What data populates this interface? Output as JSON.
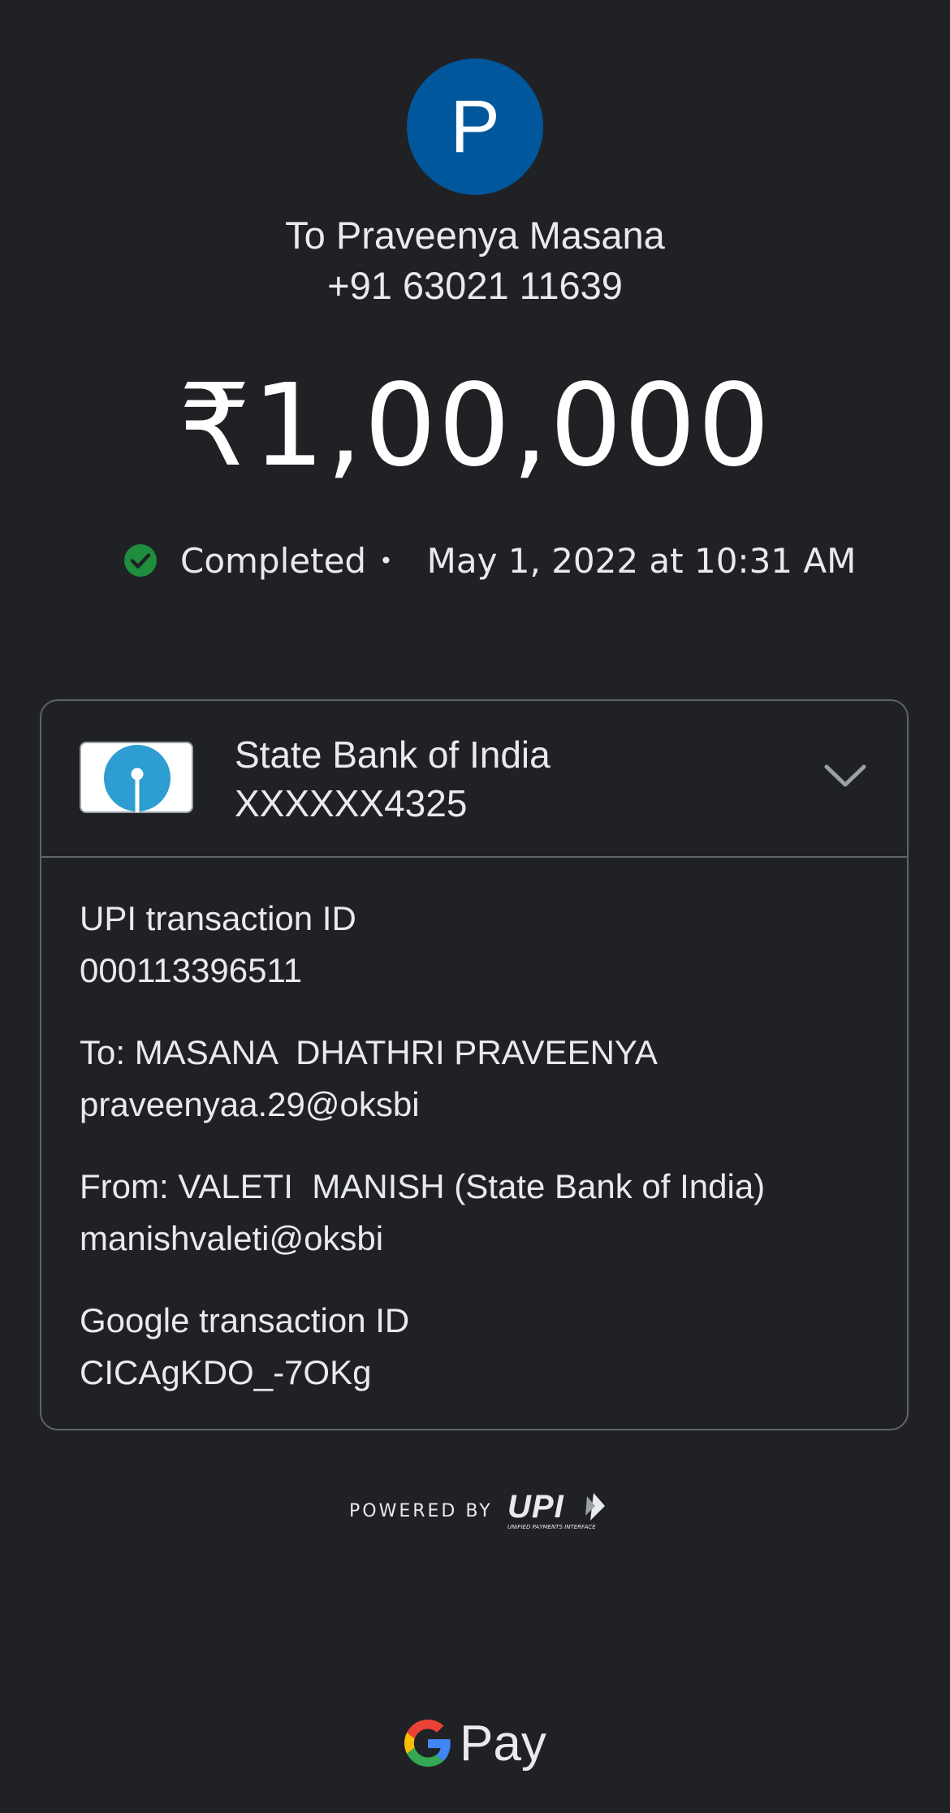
{
  "recipient": {
    "initial": "P",
    "name": "To Praveenya Masana",
    "phone": "+91 63021 11639"
  },
  "payment": {
    "amount": "₹1,00,000",
    "status": "Completed",
    "separator": "•",
    "datetime": "May 1, 2022 at 10:31 AM"
  },
  "bank": {
    "name": "State Bank of India",
    "account": "XXXXXX4325"
  },
  "details": [
    {
      "label": "UPI transaction ID",
      "value": "000113396511"
    },
    {
      "label": "To: MASANA  DHATHRI PRAVEENYA",
      "value": "praveenyaa.29@oksbi"
    },
    {
      "label": "From: VALETI  MANISH (State Bank of India)",
      "value": "manishvaleti@oksbi"
    },
    {
      "label": "Google transaction ID",
      "value": "CICAgKDO_-7OKg"
    }
  ],
  "footer": {
    "powered_by": "POWERED BY",
    "upi_logo_text": "UPI",
    "upi_logo_subtext": "UNIFIED PAYMENTS INTERFACE",
    "brand": "Pay"
  },
  "colors": {
    "background": "#202124",
    "avatar": "#01579b",
    "success": "#1e8e3e",
    "sbi_blue": "#2d9dd2",
    "border": "#5f6368"
  },
  "icons": {
    "status": "check-circle-icon",
    "expand": "chevron-down-icon",
    "bank": "sbi-logo-icon",
    "google": "google-g-icon"
  }
}
